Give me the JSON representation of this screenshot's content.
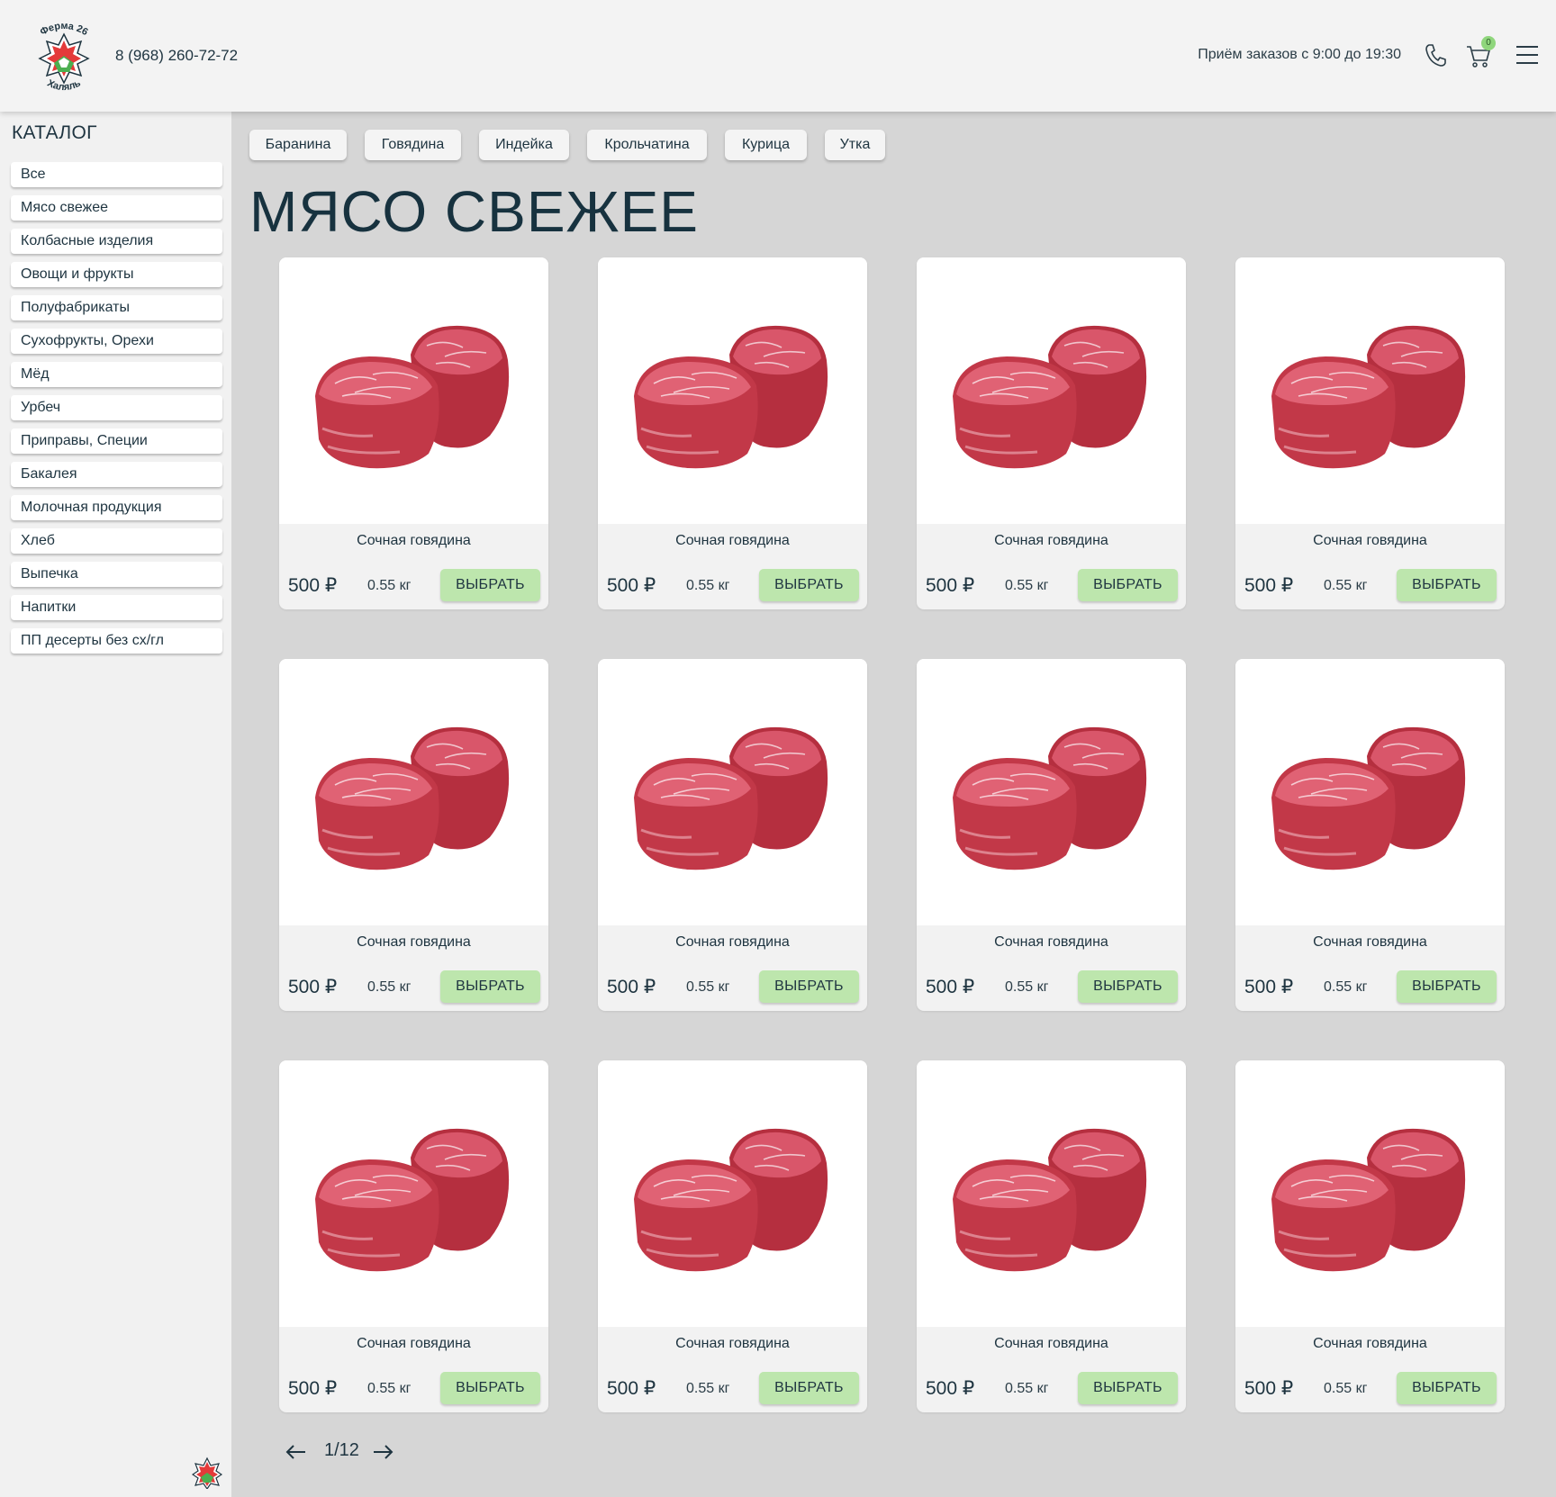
{
  "header": {
    "logo_top_text": "Ферма 26",
    "logo_bottom_text": "Халяль",
    "phone": "8 (968) 260-72-72",
    "hours": "Приём заказов с 9:00 до 19:30",
    "cart_count": "0",
    "icons": [
      "phone-icon",
      "cart-icon",
      "menu-icon"
    ]
  },
  "sidebar": {
    "title": "КАТАЛОГ",
    "items": [
      {
        "label": "Все"
      },
      {
        "label": "Мясо свежее"
      },
      {
        "label": "Колбасные изделия"
      },
      {
        "label": "Овощи и фрукты"
      },
      {
        "label": "Полуфабрикаты"
      },
      {
        "label": "Сухофрукты, Орехи"
      },
      {
        "label": "Мёд"
      },
      {
        "label": "Урбеч"
      },
      {
        "label": "Приправы, Специи"
      },
      {
        "label": "Бакалея"
      },
      {
        "label": "Молочная продукция"
      },
      {
        "label": "Хлеб"
      },
      {
        "label": "Выпечка"
      },
      {
        "label": "Напитки"
      },
      {
        "label": "ПП десерты без сх/гл"
      }
    ]
  },
  "tabs": [
    {
      "label": "Баранина"
    },
    {
      "label": "Говядина"
    },
    {
      "label": "Индейка"
    },
    {
      "label": "Крольчатина"
    },
    {
      "label": "Курица"
    },
    {
      "label": "Утка"
    }
  ],
  "page_title": "МЯСО СВЕЖЕЕ",
  "products": [
    {
      "name": "Сочная говядина",
      "price": "500 ₽",
      "weight": "0.55 кг",
      "button": "ВЫБРАТЬ"
    },
    {
      "name": "Сочная говядина",
      "price": "500 ₽",
      "weight": "0.55 кг",
      "button": "ВЫБРАТЬ"
    },
    {
      "name": "Сочная говядина",
      "price": "500 ₽",
      "weight": "0.55 кг",
      "button": "ВЫБРАТЬ"
    },
    {
      "name": "Сочная говядина",
      "price": "500 ₽",
      "weight": "0.55 кг",
      "button": "ВЫБРАТЬ"
    },
    {
      "name": "Сочная говядина",
      "price": "500 ₽",
      "weight": "0.55 кг",
      "button": "ВЫБРАТЬ"
    },
    {
      "name": "Сочная говядина",
      "price": "500 ₽",
      "weight": "0.55 кг",
      "button": "ВЫБРАТЬ"
    },
    {
      "name": "Сочная говядина",
      "price": "500 ₽",
      "weight": "0.55 кг",
      "button": "ВЫБРАТЬ"
    },
    {
      "name": "Сочная говядина",
      "price": "500 ₽",
      "weight": "0.55 кг",
      "button": "ВЫБРАТЬ"
    },
    {
      "name": "Сочная говядина",
      "price": "500 ₽",
      "weight": "0.55 кг",
      "button": "ВЫБРАТЬ"
    },
    {
      "name": "Сочная говядина",
      "price": "500 ₽",
      "weight": "0.55 кг",
      "button": "ВЫБРАТЬ"
    },
    {
      "name": "Сочная говядина",
      "price": "500 ₽",
      "weight": "0.55 кг",
      "button": "ВЫБРАТЬ"
    },
    {
      "name": "Сочная говядина",
      "price": "500 ₽",
      "weight": "0.55 кг",
      "button": "ВЫБРАТЬ"
    }
  ],
  "pagination": {
    "text": "1/12"
  },
  "colors": {
    "accent_button": "#bde6ad",
    "title": "#17323f",
    "background": "#d6d6d6",
    "sidebar": "#f1f1f1",
    "badge": "#8fd67c"
  }
}
